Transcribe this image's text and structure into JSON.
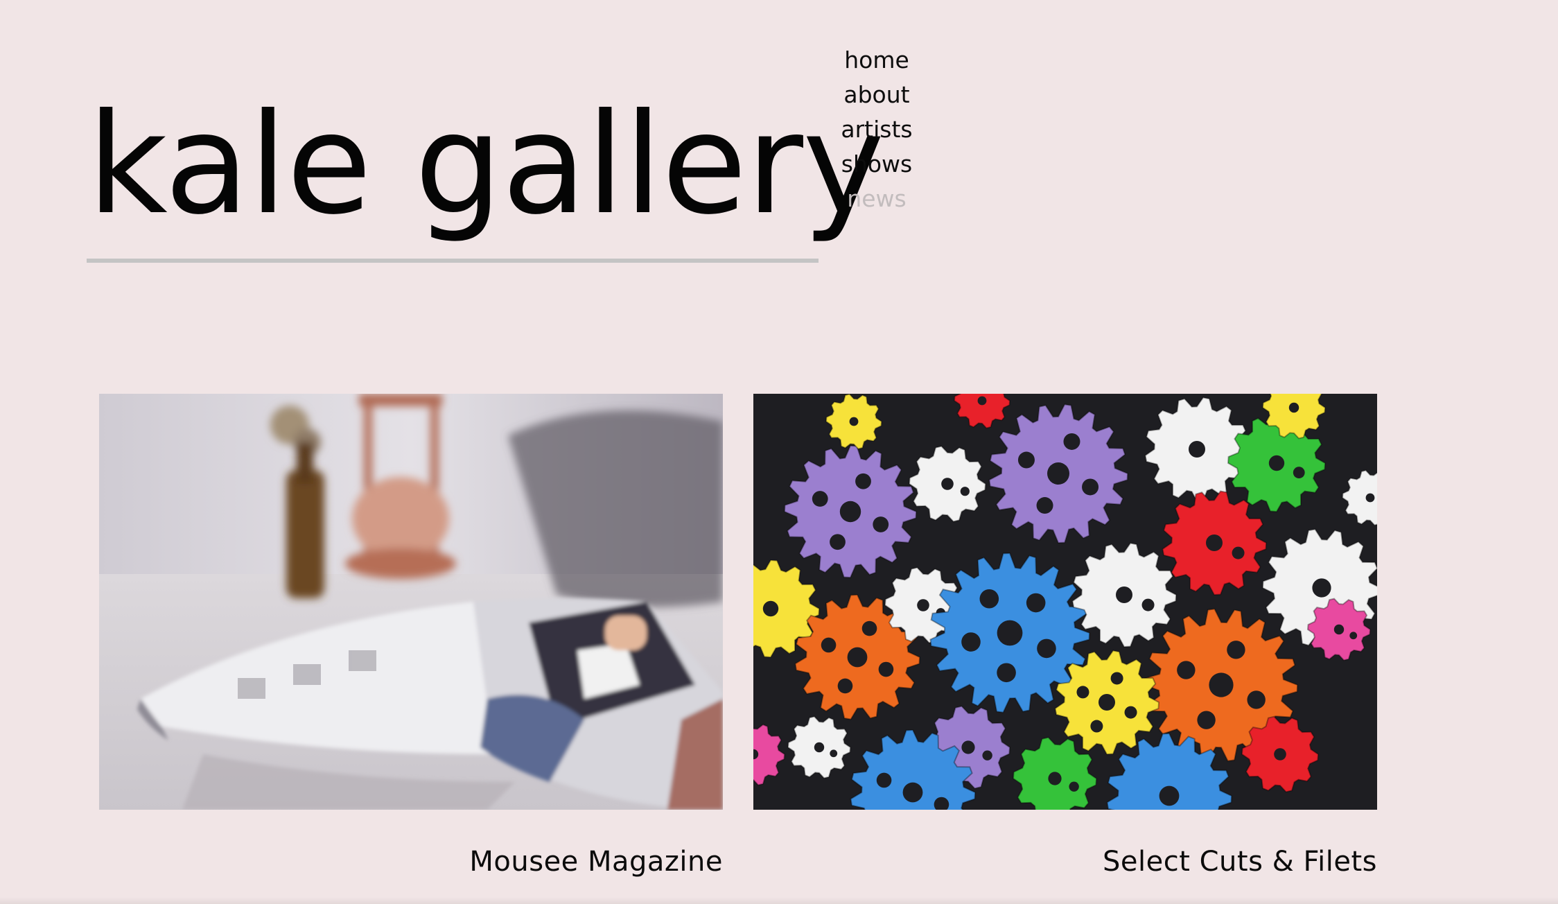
{
  "site": {
    "title": "kale gallery"
  },
  "nav": {
    "items": [
      {
        "label": "home",
        "active": false
      },
      {
        "label": "about",
        "active": false
      },
      {
        "label": "artists",
        "active": false
      },
      {
        "label": "shows",
        "active": false
      },
      {
        "label": "news",
        "active": true
      }
    ]
  },
  "posts": [
    {
      "caption": "Mousee Magazine"
    },
    {
      "caption": "Select Cuts & Filets"
    }
  ],
  "colors": {
    "background": "#f1e5e6",
    "text": "#0b0b0b",
    "nav_active": "#c2bcbd",
    "rule": "#c4c4c4"
  }
}
